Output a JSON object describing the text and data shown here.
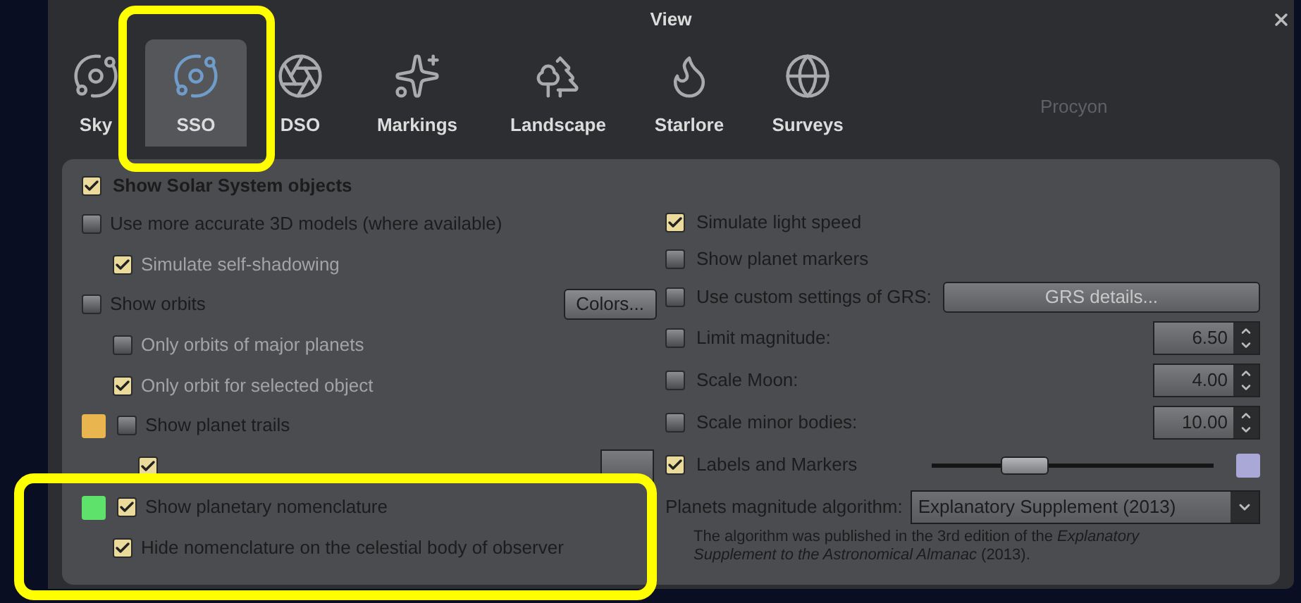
{
  "window": {
    "title": "View"
  },
  "background_labels": [
    "Procyon"
  ],
  "tabs": [
    {
      "label": "Sky",
      "selected": false
    },
    {
      "label": "SSO",
      "selected": true
    },
    {
      "label": "DSO",
      "selected": false
    },
    {
      "label": "Markings",
      "selected": false
    },
    {
      "label": "Landscape",
      "selected": false
    },
    {
      "label": "Starlore",
      "selected": false
    },
    {
      "label": "Surveys",
      "selected": false
    }
  ],
  "main_option": {
    "label": "Show Solar System objects",
    "checked": true
  },
  "left_options": [
    {
      "kind": "checkbox",
      "label": "Use more accurate 3D models (where available)",
      "checked": false,
      "children": [
        {
          "kind": "checkbox",
          "label": "Simulate self-shadowing",
          "checked": true,
          "disabled": true
        }
      ]
    },
    {
      "kind": "checkbox",
      "label": "Show orbits",
      "checked": false,
      "button": "Colors...",
      "children": [
        {
          "kind": "checkbox",
          "label": "Only orbits of major planets",
          "checked": false,
          "disabled": true
        },
        {
          "kind": "checkbox",
          "label": "Only orbit for selected object",
          "checked": true,
          "disabled": true
        }
      ]
    },
    {
      "kind": "swatch",
      "color": "#e9b54e",
      "label": "Show planet trails",
      "checked": false,
      "children": [
        {
          "kind": "spin",
          "checked": true
        }
      ]
    },
    {
      "kind": "swatch",
      "color": "#5fe26b",
      "label": "Show planetary nomenclature",
      "checked": true,
      "children": [
        {
          "kind": "checkbox",
          "label": "Hide nomenclature on the celestial body of observer",
          "checked": true,
          "disabled": false
        }
      ]
    }
  ],
  "right_options": [
    {
      "kind": "checkbox",
      "label": "Simulate light speed",
      "checked": true
    },
    {
      "kind": "checkbox",
      "label": "Show planet markers",
      "checked": false
    },
    {
      "kind": "button",
      "label": "Use custom settings of GRS:",
      "checked": false,
      "button": "GRS details..."
    },
    {
      "kind": "spin",
      "label": "Limit magnitude:",
      "checked": false,
      "value": "6.50"
    },
    {
      "kind": "spin",
      "label": "Scale Moon:",
      "checked": false,
      "value": "4.00"
    },
    {
      "kind": "spin",
      "label": "Scale minor bodies:",
      "checked": false,
      "value": "10.00"
    },
    {
      "kind": "slider",
      "label": "Labels and Markers",
      "checked": true,
      "level": 0.33,
      "color": "#a9a8d6"
    },
    {
      "kind": "select",
      "label": "Planets magnitude algorithm:",
      "value": "Explanatory Supplement (2013)"
    },
    {
      "kind": "note",
      "text": "The algorithm was published in the 3rd edition of the *Explanatory Supplement to the Astronomical Almanac* (2013)."
    }
  ]
}
